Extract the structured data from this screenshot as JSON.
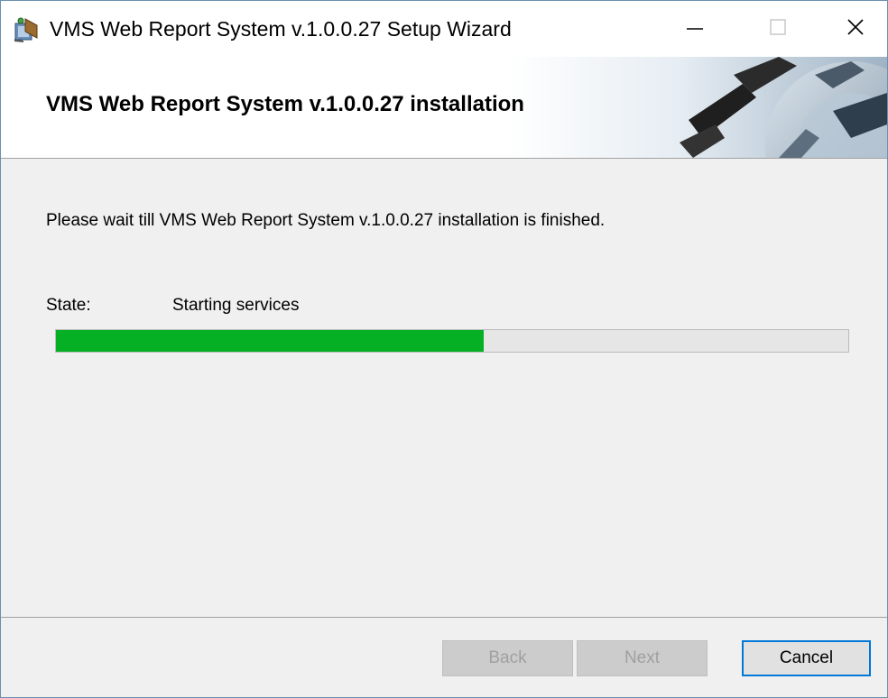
{
  "window": {
    "title": "VMS Web Report System v.1.0.0.27 Setup Wizard",
    "icon": "installer-package-icon",
    "controls": {
      "minimize": "minimize-icon",
      "maximize": "maximize-icon",
      "close": "close-icon"
    }
  },
  "banner": {
    "title": "VMS Web Report System v.1.0.0.27 installation",
    "art": "gears-icon"
  },
  "main": {
    "message": "Please wait till VMS Web Report System v.1.0.0.27 installation is finished.",
    "state_label": "State:",
    "state_value": "Starting services",
    "progress_fraction": 0.54,
    "progress_color": "#06b025"
  },
  "footer": {
    "back_label": "Back",
    "next_label": "Next",
    "cancel_label": "Cancel"
  }
}
